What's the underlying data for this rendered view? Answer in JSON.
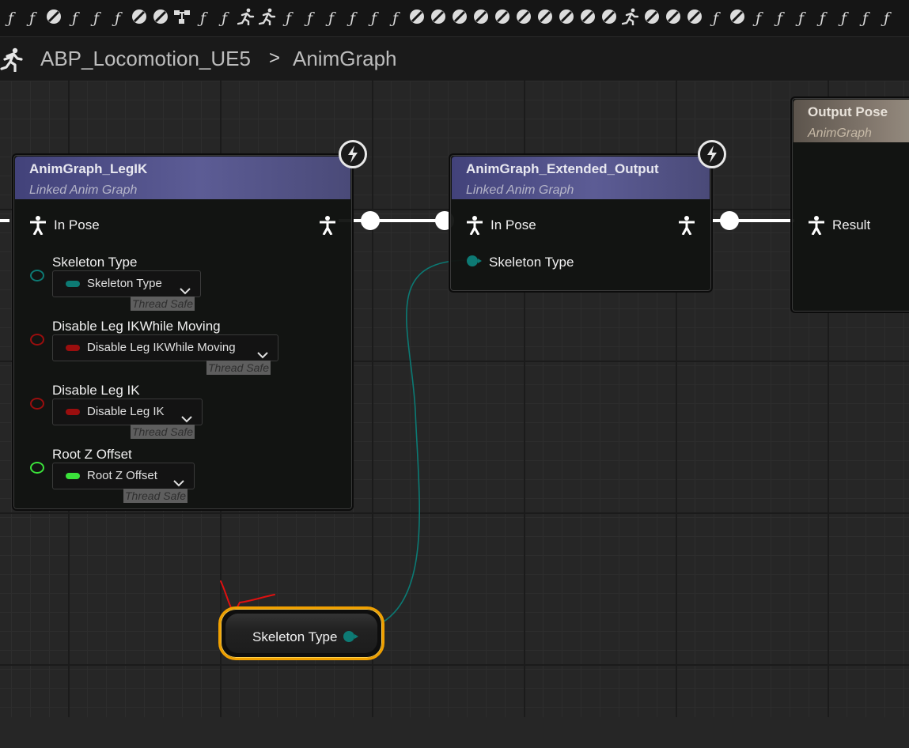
{
  "toolbar": {
    "icons": [
      "function-icon",
      "function-icon",
      "disabled-icon",
      "function-icon",
      "function-icon",
      "function-icon",
      "disabled-icon",
      "disabled-icon",
      "graph-icon",
      "function-icon",
      "function-icon",
      "running-icon",
      "running-icon",
      "function-icon",
      "function-icon",
      "function-icon",
      "function-icon",
      "function-icon",
      "function-icon",
      "disabled-icon",
      "disabled-icon",
      "disabled-icon",
      "disabled-icon",
      "disabled-icon",
      "disabled-icon",
      "disabled-icon",
      "disabled-icon",
      "disabled-icon",
      "disabled-icon",
      "running-icon",
      "disabled-icon",
      "disabled-icon",
      "disabled-icon",
      "function-icon",
      "disabled-icon",
      "function-icon",
      "function-icon",
      "function-icon",
      "function-icon",
      "function-icon",
      "function-icon",
      "function-icon"
    ]
  },
  "breadcrumb": {
    "blueprint": "ABP_Locomotion_UE5",
    "separator": ">",
    "graph": "AnimGraph"
  },
  "nodes": {
    "leg_ik": {
      "title": "AnimGraph_LegIK",
      "subtitle": "Linked Anim Graph",
      "in_pose": "In Pose",
      "params": [
        {
          "label": "Skeleton Type",
          "value": "Skeleton Type",
          "badge": "Thread Safe",
          "color": "#0d7a74"
        },
        {
          "label": "Disable Leg IKWhile Moving",
          "value": "Disable Leg IKWhile Moving",
          "badge": "Thread Safe",
          "color": "#9a0e0e"
        },
        {
          "label": "Disable Leg IK",
          "value": "Disable Leg IK",
          "badge": "Thread Safe",
          "color": "#9a0e0e"
        },
        {
          "label": "Root Z Offset",
          "value": "Root Z Offset",
          "badge": "Thread Safe",
          "color": "#3be23b"
        }
      ]
    },
    "extended": {
      "title": "AnimGraph_Extended_Output",
      "subtitle": "Linked Anim Graph",
      "in_pose": "In Pose",
      "skeleton_type": "Skeleton Type"
    },
    "output": {
      "title": "Output Pose",
      "subtitle": "AnimGraph",
      "result": "Result"
    },
    "variable": {
      "label": "Skeleton Type"
    }
  },
  "colors": {
    "pose_wire": "#ffffff",
    "enum_pin": "#0d7a74",
    "bool_pin": "#9a0e0e",
    "float_pin": "#3be23b",
    "selection": "#f0a000",
    "annotation": "#e01010"
  }
}
